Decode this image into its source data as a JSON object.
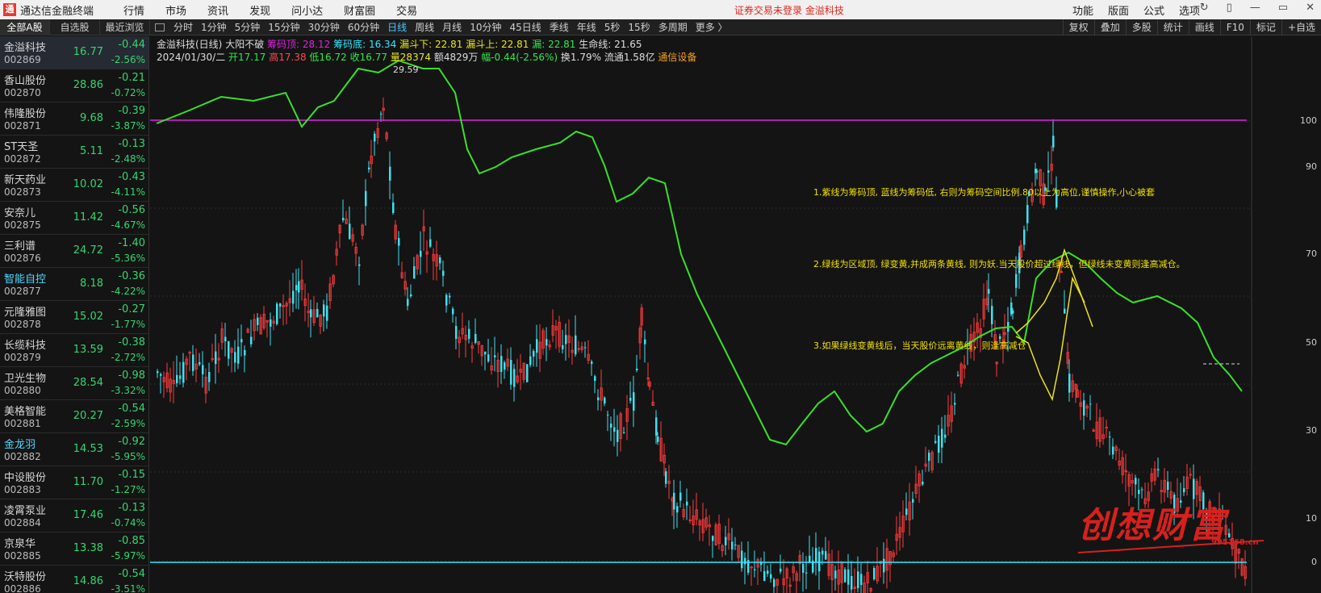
{
  "app": {
    "title": "通达信金融终端",
    "menus": [
      "行情",
      "市场",
      "资讯",
      "发现",
      "问小达",
      "财富圈",
      "交易"
    ],
    "login": "证券交易未登录  金溢科技",
    "right_menus": [
      "功能",
      "版面",
      "公式",
      "选项"
    ],
    "win_controls": [
      "↻",
      "▯",
      "—",
      "▭",
      "✕"
    ]
  },
  "left_tabs": [
    "全部A股",
    "自选股",
    "最近浏览"
  ],
  "periods": [
    "分时",
    "1分钟",
    "5分钟",
    "15分钟",
    "30分钟",
    "60分钟",
    "日线",
    "周线",
    "月线",
    "10分钟",
    "45日线",
    "季线",
    "年线",
    "5秒",
    "15秒",
    "多周期",
    "更多 〉"
  ],
  "right_tools": [
    "复权",
    "叠加",
    "多股",
    "统计",
    "画线",
    "F10",
    "标记",
    "+自选"
  ],
  "stocks": [
    {
      "name": "金溢科技",
      "code": "002869",
      "price": "16.77",
      "chg": "-0.44",
      "pct": "-2.56%"
    },
    {
      "name": "香山股份",
      "code": "002870",
      "price": "28.86",
      "chg": "-0.21",
      "pct": "-0.72%"
    },
    {
      "name": "伟隆股份",
      "code": "002871",
      "price": "9.68",
      "chg": "-0.39",
      "pct": "-3.87%"
    },
    {
      "name": "ST天圣",
      "code": "002872",
      "price": "5.11",
      "chg": "-0.13",
      "pct": "-2.48%"
    },
    {
      "name": "新天药业",
      "code": "002873",
      "price": "10.02",
      "chg": "-0.43",
      "pct": "-4.11%"
    },
    {
      "name": "安奈儿",
      "code": "002875",
      "price": "11.42",
      "chg": "-0.56",
      "pct": "-4.67%"
    },
    {
      "name": "三利谱",
      "code": "002876",
      "price": "24.72",
      "chg": "-1.40",
      "pct": "-5.36%"
    },
    {
      "name": "智能自控",
      "code": "002877",
      "price": "8.18",
      "chg": "-0.36",
      "pct": "-4.22%"
    },
    {
      "name": "元隆雅图",
      "code": "002878",
      "price": "15.02",
      "chg": "-0.27",
      "pct": "-1.77%"
    },
    {
      "name": "长缆科技",
      "code": "002879",
      "price": "13.59",
      "chg": "-0.38",
      "pct": "-2.72%"
    },
    {
      "name": "卫光生物",
      "code": "002880",
      "price": "28.54",
      "chg": "-0.98",
      "pct": "-3.32%"
    },
    {
      "name": "美格智能",
      "code": "002881",
      "price": "20.27",
      "chg": "-0.54",
      "pct": "-2.59%"
    },
    {
      "name": "金龙羽",
      "code": "002882",
      "price": "14.53",
      "chg": "-0.92",
      "pct": "-5.95%"
    },
    {
      "name": "中设股份",
      "code": "002883",
      "price": "11.70",
      "chg": "-0.15",
      "pct": "-1.27%"
    },
    {
      "name": "凌霄泵业",
      "code": "002884",
      "price": "17.46",
      "chg": "-0.13",
      "pct": "-0.74%"
    },
    {
      "name": "京泉华",
      "code": "002885",
      "price": "13.38",
      "chg": "-0.85",
      "pct": "-5.97%"
    },
    {
      "name": "沃特股份",
      "code": "002886",
      "price": "14.86",
      "chg": "-0.54",
      "pct": "-3.51%"
    }
  ],
  "info": {
    "title": "金溢科技(日线)",
    "formula": "大阳不破",
    "chip_top_label": "筹码顶: 28.12",
    "chip_bottom_label": "筹码底: 16.34",
    "leak_down": "漏斗下: 22.81",
    "leak_up": "漏斗上: 22.81",
    "leak": "漏: 22.81",
    "life_line": "生命线: 21.65",
    "date": "2024/01/30/二",
    "open": "开17.17",
    "high": "高17.38",
    "low": "低16.72",
    "close": "收16.77",
    "volume": "量28374",
    "amount": "额4829万",
    "range": "幅-0.44(-2.56%)",
    "turnover": "换1.79%",
    "float": "流通1.58亿",
    "sector": "通信设备"
  },
  "annotations": [
    "1.紫线为筹码顶, 蓝线为筹码低, 右则为筹码空间比例.80以上为高位,谨慎操作,小心被套",
    "2.绿线为区域顶, 绿变黄,并成两条黄线, 则为妖.当天股价超过绿线，但绿线未变黄则逢高减仓。",
    "3.如果绿线变黄线后，当天股价远离黄线，则逢高减仓"
  ],
  "peak_label": "29.59",
  "axis_labels": [
    "100",
    "90",
    "70",
    "50",
    "30",
    "10",
    "0"
  ],
  "watermark": "创想财富",
  "watermark_url": "995168.cn",
  "chart_data": {
    "type": "candlestick",
    "title": "金溢科技(日线)",
    "y_axis_ticks": [
      100,
      90,
      70,
      50,
      30,
      10,
      0
    ],
    "purple_line_level": 100,
    "cyan_line_level": 0,
    "last_candle": {
      "open": 17.17,
      "high": 17.38,
      "low": 16.72,
      "close": 16.77
    },
    "peak_high": 29.59
  },
  "colors": {
    "up": "#ff3b3b",
    "down": "#3fe0ef",
    "green_line": "#39e02a",
    "yellow_line": "#ece21a",
    "purple": "#e21fe3",
    "cyan": "#30e6ff"
  }
}
